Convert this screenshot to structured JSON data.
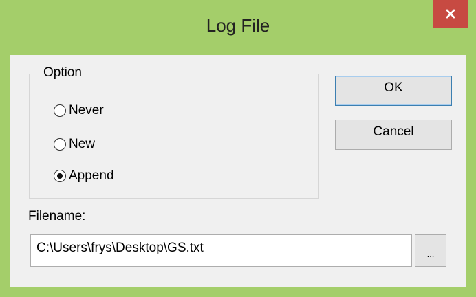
{
  "window": {
    "title": "Log File",
    "close_glyph": "×"
  },
  "option_group": {
    "legend": "Option",
    "options": [
      {
        "label": "Never",
        "checked": false
      },
      {
        "label": "New",
        "checked": false
      },
      {
        "label": "Append",
        "checked": true
      }
    ]
  },
  "buttons": {
    "ok_label": "OK",
    "cancel_label": "Cancel",
    "browse_label": "..."
  },
  "filename": {
    "label": "Filename:",
    "value": "C:\\Users\\frys\\Desktop\\GS.txt"
  },
  "colors": {
    "title_bar": "#a4ce6a",
    "close_button": "#c74a42",
    "dialog_background": "#f0f0f0",
    "default_button_border": "#3c7fb1"
  },
  "icons": {
    "close": "close-icon",
    "radio_selected": "radio-checked-icon",
    "radio_unselected": "radio-unchecked-icon"
  }
}
